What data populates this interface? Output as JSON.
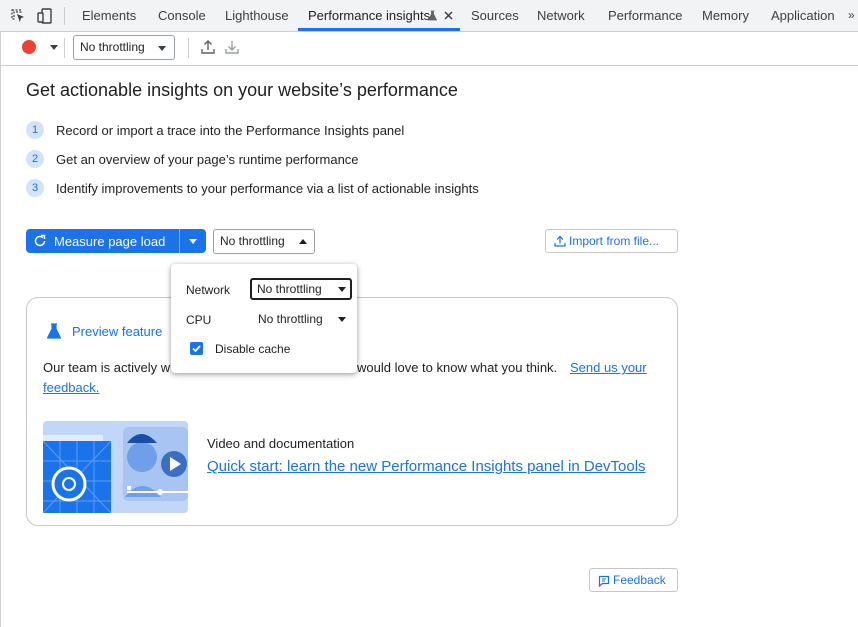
{
  "tabs": [
    {
      "label": "Elements"
    },
    {
      "label": "Console"
    },
    {
      "label": "Lighthouse"
    },
    {
      "label": "Performance insights"
    },
    {
      "label": "Sources"
    },
    {
      "label": "Network"
    },
    {
      "label": "Performance"
    },
    {
      "label": "Memory"
    },
    {
      "label": "Application"
    }
  ],
  "toolbar": {
    "throttling_value": "No throttling"
  },
  "main": {
    "heading": "Get actionable insights on your website’s performance",
    "steps": [
      {
        "num": "1",
        "text": "Record or import a trace into the Performance Insights panel"
      },
      {
        "num": "2",
        "text": "Get an overview of your page’s runtime performance"
      },
      {
        "num": "3",
        "text": "Identify improvements to your performance via a list of actionable insights"
      }
    ],
    "measure_label": "Measure page load",
    "throttle_value": "No throttling",
    "import_label": "Import from file..."
  },
  "card": {
    "preview_title": "Preview feature",
    "body_prefix": "Our team is actively w",
    "body_middle": "would love to know what you think.",
    "send_link_part1": "Send us your",
    "send_link_part2": "feedback.",
    "video_heading": "Video and documentation",
    "quickstart_link": "Quick start: learn the new Performance Insights panel in DevTools"
  },
  "popup": {
    "network_label": "Network",
    "network_value": "No throttling",
    "cpu_label": "CPU",
    "cpu_value": "No throttling",
    "disable_cache_label": "Disable cache",
    "disable_cache_checked": true
  },
  "feedback_label": "Feedback",
  "colors": {
    "accent": "#1a73e8",
    "record": "#ea4335"
  }
}
